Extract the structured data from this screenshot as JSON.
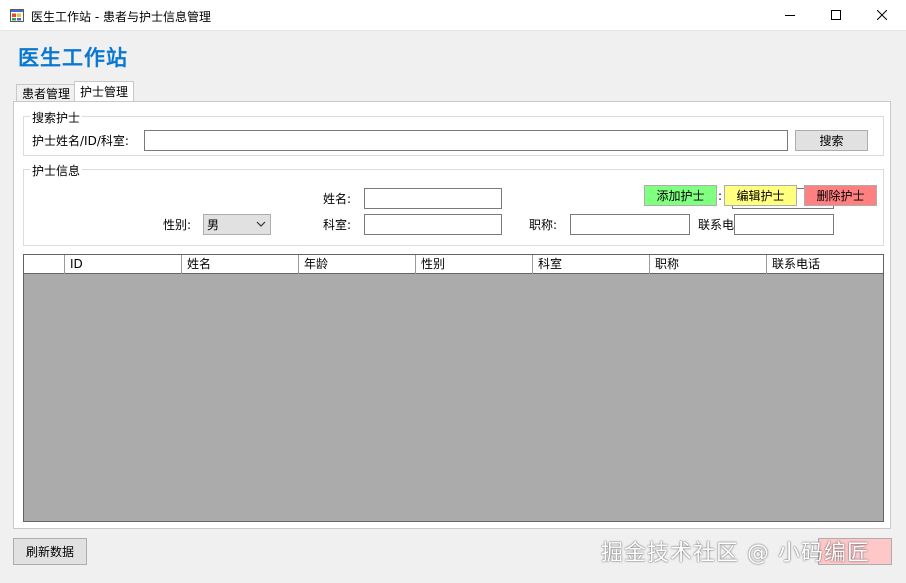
{
  "window": {
    "title": "医生工作站 - 患者与护士信息管理",
    "controls": {
      "minimize": "minimize-icon",
      "maximize": "maximize-icon",
      "close": "close-icon"
    }
  },
  "header": {
    "title": "医生工作站"
  },
  "tabs": [
    {
      "label": "患者管理",
      "selected": false
    },
    {
      "label": "护士管理",
      "selected": true
    }
  ],
  "search": {
    "group_title": "搜索护士",
    "field_label": "护士姓名/ID/科室:",
    "field_value": "",
    "button_label": "搜索"
  },
  "info": {
    "group_title": "护士信息",
    "name_label": "姓名:",
    "name_value": "",
    "gender_label": "性别:",
    "gender_value": "男",
    "dept_label": "科室:",
    "dept_value": "",
    "title_label": "职称:",
    "title_value": "",
    "phone_label": "联系电",
    "phone_value": "",
    "stub_text": ":",
    "add_label": "添加护士",
    "edit_label": "编辑护士",
    "delete_label": "删除护士",
    "colors": {
      "add": "#80ff80",
      "edit": "#ffff80",
      "delete": "#ff8080"
    }
  },
  "grid": {
    "columns": [
      "",
      "ID",
      "姓名",
      "年龄",
      "性别",
      "科室",
      "职称",
      "联系电话"
    ],
    "rows": [],
    "background": "#ababab"
  },
  "footer": {
    "refresh_label": "刷新数据",
    "watermark": "掘金技术社区 @ 小码编匠"
  }
}
